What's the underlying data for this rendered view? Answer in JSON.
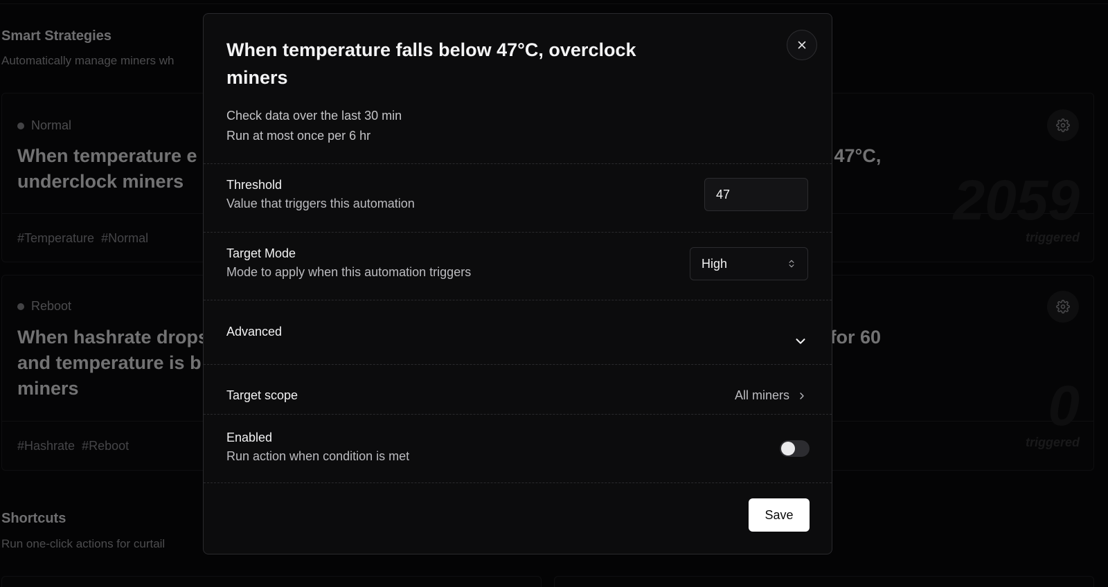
{
  "background": {
    "section1": {
      "title": "Smart Strategies",
      "subtitle": "Automatically manage miners wh"
    },
    "cards": [
      {
        "status": "Normal",
        "title_line1": "When temperature e",
        "title_line2": "underclock miners",
        "tags": [
          "#Temperature",
          "#Normal"
        ]
      },
      {
        "title_line1": "w 47°C,",
        "count": "2059",
        "count_label": "triggered"
      },
      {
        "status": "Reboot",
        "title_line1": "When hashrate drops",
        "title_line2": "and temperature is b",
        "title_line3": "miners",
        "tags": [
          "#Hashrate",
          "#Reboot"
        ]
      },
      {
        "title_line1": "e for 60",
        "count": "0",
        "count_label": "triggered"
      }
    ],
    "section2": {
      "title": "Shortcuts",
      "subtitle": "Run one-click actions for curtail"
    }
  },
  "modal": {
    "title": "When temperature falls below 47°C, overclock miners",
    "meta_line1": "Check data over the last 30 min",
    "meta_line2": "Run at most once per 6 hr",
    "threshold": {
      "label": "Threshold",
      "description": "Value that triggers this automation",
      "value": "47"
    },
    "target_mode": {
      "label": "Target Mode",
      "description": "Mode to apply when this automation triggers",
      "selected": "High"
    },
    "advanced": {
      "label": "Advanced"
    },
    "target_scope": {
      "label": "Target scope",
      "value": "All miners"
    },
    "enabled": {
      "label": "Enabled",
      "description": "Run action when condition is met",
      "on": false
    },
    "save_label": "Save"
  }
}
